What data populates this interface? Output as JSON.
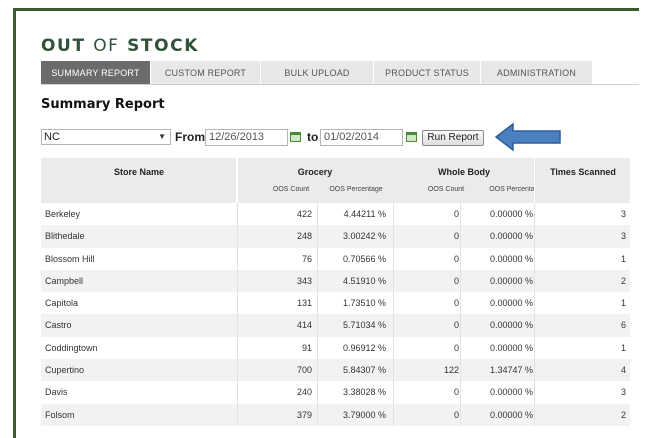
{
  "brand": {
    "word1": "OUT",
    "word2": "OF",
    "word3": "STOCK"
  },
  "tabs": [
    {
      "label": "SUMMARY REPORT",
      "active": true
    },
    {
      "label": "CUSTOM REPORT",
      "active": false
    },
    {
      "label": "BULK UPLOAD",
      "active": false
    },
    {
      "label": "PRODUCT STATUS",
      "active": false
    },
    {
      "label": "ADMINISTRATION",
      "active": false
    }
  ],
  "page_title": "Summary Report",
  "filters": {
    "region": "NC",
    "from_label": "From",
    "from_date": "12/26/2013",
    "to_label": "to",
    "to_date": "01/02/2014",
    "run_label": "Run Report"
  },
  "colors": {
    "accent": "#2f5238",
    "frame": "#3d5a2c",
    "arrow": "#4a7fc0",
    "tab_active": "#6b6b6b"
  },
  "table": {
    "headers": {
      "store": "Store Name",
      "grocery": "Grocery",
      "whole_body": "Whole Body",
      "times_scanned": "Times Scanned",
      "oos_count": "OOS Count",
      "oos_percentage": "OOS Percentage",
      "oos_percentage_cut": "OOS Percenta"
    },
    "rows": [
      {
        "store": "Berkeley",
        "g_count": "422",
        "g_pct": "4.44211 %",
        "w_count": "0",
        "w_pct": "0.00000 %",
        "scanned": "3"
      },
      {
        "store": "Blithedale",
        "g_count": "248",
        "g_pct": "3.00242 %",
        "w_count": "0",
        "w_pct": "0.00000 %",
        "scanned": "3"
      },
      {
        "store": "Blossom Hill",
        "g_count": "76",
        "g_pct": "0.70566 %",
        "w_count": "0",
        "w_pct": "0.00000 %",
        "scanned": "1"
      },
      {
        "store": "Campbell",
        "g_count": "343",
        "g_pct": "4.51910 %",
        "w_count": "0",
        "w_pct": "0.00000 %",
        "scanned": "2"
      },
      {
        "store": "Capitola",
        "g_count": "131",
        "g_pct": "1.73510 %",
        "w_count": "0",
        "w_pct": "0.00000 %",
        "scanned": "1"
      },
      {
        "store": "Castro",
        "g_count": "414",
        "g_pct": "5.71034 %",
        "w_count": "0",
        "w_pct": "0.00000 %",
        "scanned": "6"
      },
      {
        "store": "Coddingtown",
        "g_count": "91",
        "g_pct": "0.96912 %",
        "w_count": "0",
        "w_pct": "0.00000 %",
        "scanned": "1"
      },
      {
        "store": "Cupertino",
        "g_count": "700",
        "g_pct": "5.84307 %",
        "w_count": "122",
        "w_pct": "1.34747 %",
        "scanned": "4"
      },
      {
        "store": "Davis",
        "g_count": "240",
        "g_pct": "3.38028 %",
        "w_count": "0",
        "w_pct": "0.00000 %",
        "scanned": "3"
      },
      {
        "store": "Folsom",
        "g_count": "379",
        "g_pct": "3.79000 %",
        "w_count": "0",
        "w_pct": "0.00000 %",
        "scanned": "2"
      }
    ]
  }
}
